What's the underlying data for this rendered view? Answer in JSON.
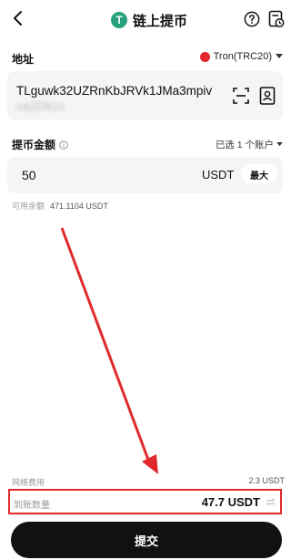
{
  "header": {
    "title": "链上提币",
    "coin_glyph": "T",
    "coin_color": "#26a17b"
  },
  "address": {
    "label": "地址",
    "network": "Tron(TRC20)",
    "network_color": "#e0272f",
    "value_visible": "TLguwk32UZRnKbJRVk1JMa3mpiv",
    "value_obscured": "ua2Dk1x"
  },
  "amount": {
    "label": "提币金额",
    "accounts": "已选 1 个账户",
    "value": "50",
    "unit": "USDT",
    "max_label": "最大",
    "available_label": "可用余额",
    "available_value": "471.1104 USDT"
  },
  "fee": {
    "label": "网络费用",
    "value": "2.3 USDT"
  },
  "receive": {
    "label": "到账数量",
    "value": "47.7 USDT"
  },
  "submit_label": "提交",
  "colors": {
    "highlight": "#e02a2a",
    "button_bg": "#111111"
  }
}
